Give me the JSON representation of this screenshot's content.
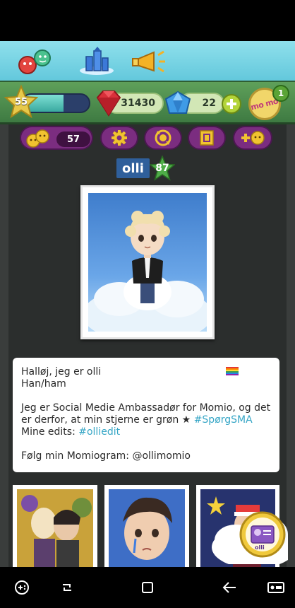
{
  "top_nav": {
    "items": [
      {
        "icon": "friends-icon"
      },
      {
        "icon": "city-icon"
      },
      {
        "icon": "megaphone-icon"
      }
    ]
  },
  "stats": {
    "level": "55",
    "xp_progress": 0.62,
    "rubies": "31430",
    "diamonds": "22",
    "notifications": "1",
    "mm_label": "mo mo"
  },
  "toolbar": {
    "friends_count": "57"
  },
  "profile": {
    "username": "olli",
    "level": "87"
  },
  "bio": {
    "line1": "Halløj, jeg er olli",
    "line2": "Han/ham",
    "line3": "Jeg er Social Medie Ambassadør for Momio, og det",
    "line4_prefix": "er derfor, at min stjerne er grøn ★",
    "line4_hashtag": "#SpørgSMA",
    "line5_prefix": "Mine edits:",
    "line5_hashtag": "#olliedit",
    "line6": "Følg min Momiogram: @ollimomio"
  },
  "badge": {
    "label": "olli"
  },
  "colors": {
    "accent_purple": "#7b2d80",
    "hashtag": "#36a6c6",
    "stats_green": "#4e8d4d"
  }
}
